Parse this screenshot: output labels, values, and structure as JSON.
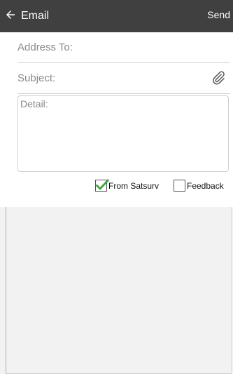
{
  "header": {
    "title": "Email",
    "send_label": "Send"
  },
  "form": {
    "address_placeholder": "Address To:",
    "subject_placeholder": "Subject:",
    "detail_placeholder": "Detail:"
  },
  "options": {
    "from_satsurv": {
      "label": "From Satsurv",
      "checked": true
    },
    "feedback": {
      "label": "Feedback",
      "checked": false
    }
  },
  "icons": {
    "back": "arrow-left-icon",
    "attach": "paperclip-icon",
    "check": "checkmark-icon"
  },
  "colors": {
    "topbar": "#404040",
    "check_green": "#3aaa35",
    "background": "#f2f2f2"
  }
}
